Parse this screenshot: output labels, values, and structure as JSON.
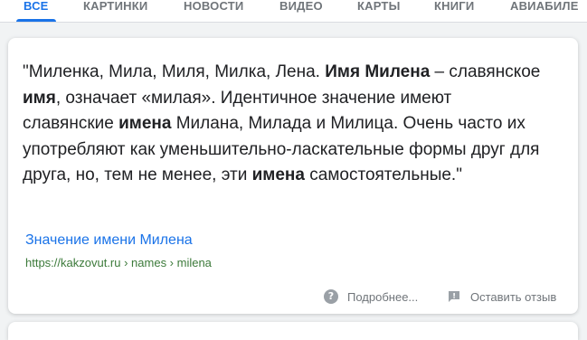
{
  "tabs": [
    {
      "label": "ВСЕ",
      "active": true
    },
    {
      "label": "КАРТИНКИ",
      "active": false
    },
    {
      "label": "НОВОСТИ",
      "active": false
    },
    {
      "label": "ВИДЕО",
      "active": false
    },
    {
      "label": "КАРТЫ",
      "active": false
    },
    {
      "label": "КНИГИ",
      "active": false
    },
    {
      "label": "АВИАБИЛЕ",
      "active": false
    }
  ],
  "snippet": {
    "parts": [
      {
        "text": "\"Миленка, Мила, Миля, Милка, Лена. ",
        "bold": false
      },
      {
        "text": "Имя Милена",
        "bold": true
      },
      {
        "text": " – славянское ",
        "bold": false
      },
      {
        "text": "имя",
        "bold": true
      },
      {
        "text": ", означает «милая». Идентичное значение имеют славянские ",
        "bold": false
      },
      {
        "text": "имена",
        "bold": true
      },
      {
        "text": " Милана, Милада и Милица. Очень часто их употребляют как уменьшительно-ласкательные формы друг для друга, но, тем не менее, эти ",
        "bold": false
      },
      {
        "text": "имена",
        "bold": true
      },
      {
        "text": " самостоятельные.\"",
        "bold": false
      }
    ]
  },
  "result": {
    "title": "Значение имени Милена",
    "url": "https://kakzovut.ru › names › milena"
  },
  "footer": {
    "more_label": "Подробнее...",
    "feedback_label": "Оставить отзыв"
  },
  "colors": {
    "accent": "#1a73e8",
    "url_green": "#3c7a3a",
    "muted": "#70757a"
  },
  "icons": {
    "more": "help-circle-icon",
    "feedback": "feedback-icon"
  }
}
